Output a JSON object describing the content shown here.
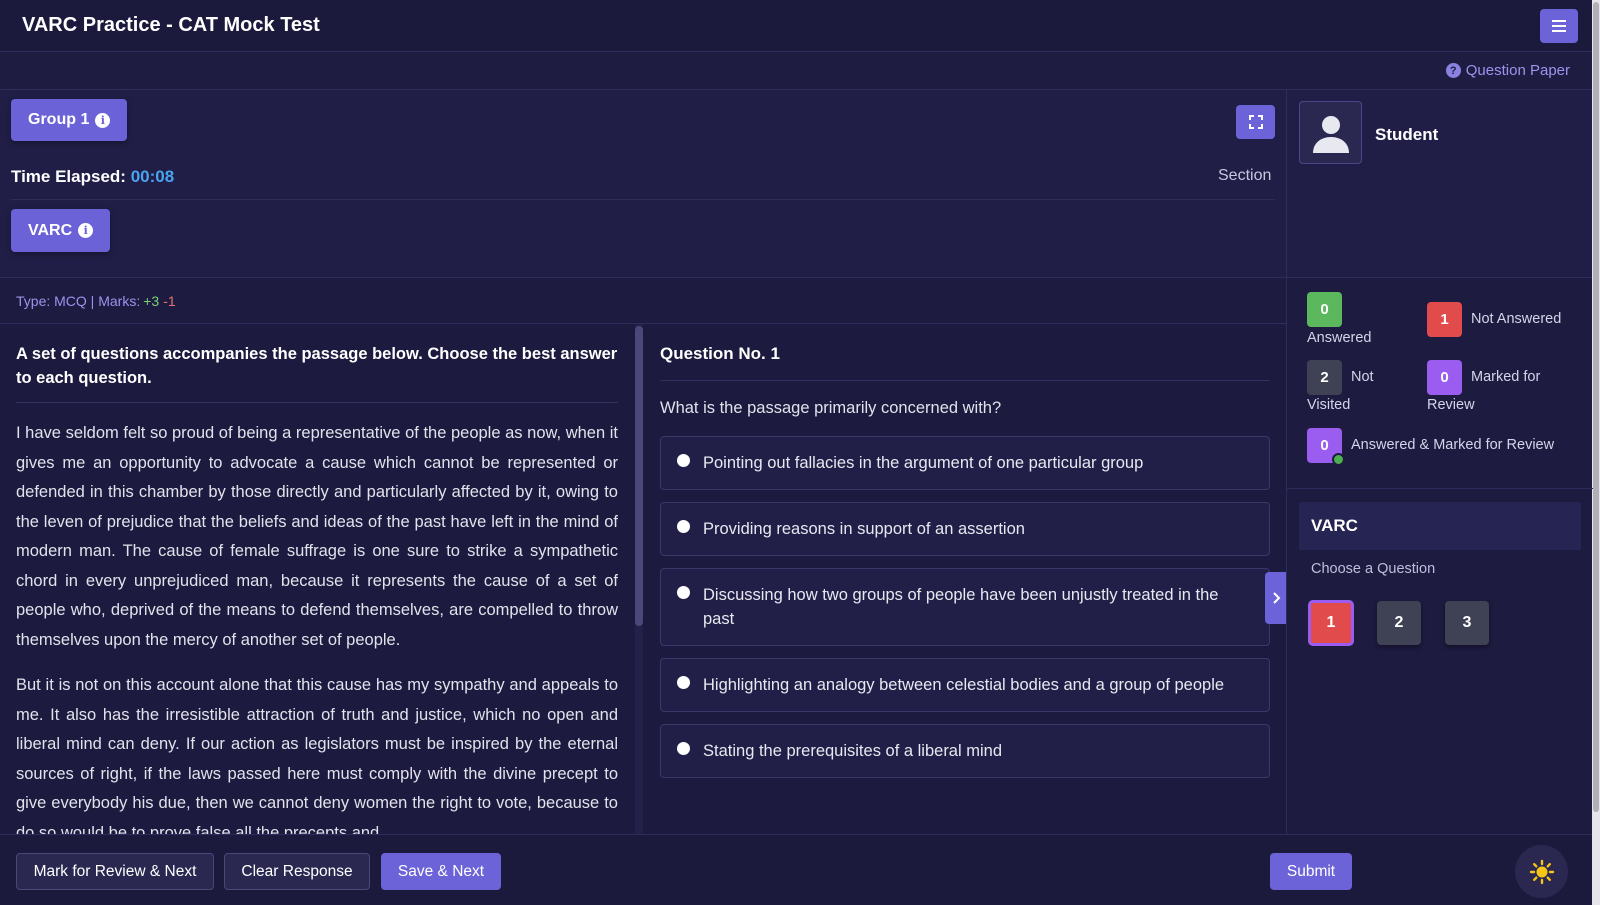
{
  "app": {
    "title": "VARC Practice - CAT Mock Test"
  },
  "toolbar": {
    "question_paper": "Question Paper"
  },
  "header": {
    "group_label": "Group 1",
    "time_label": "Time Elapsed:",
    "time_value": "00:08",
    "section_label": "Section",
    "section_tab": "VARC"
  },
  "profile": {
    "name": "Student"
  },
  "question_meta": {
    "type_text": "Type: MCQ | Marks:",
    "positive": "+3",
    "negative": "-1"
  },
  "passage": {
    "intro": "A set of questions accompanies the passage below. Choose the best answer to each question.",
    "paragraphs": [
      "I have seldom felt so proud of being a representative of the people as now, when it gives me an opportunity to advocate a cause which cannot be represented or defended in this chamber by those directly and particularly affected by it, owing to the leven of prejudice that the beliefs and ideas of the past have left in the mind of modern man. The cause of female suffrage is one sure to strike a sympathetic chord in every unprejudiced man, because it represents the cause of a set of people who, deprived of the means to defend themselves, are compelled to throw themselves upon the mercy of another set of people.",
      "But it is not on this account alone that this cause has my sympathy and appeals to me. It also has the irresistible attraction of truth and justice, which no open and liberal mind can deny. If our action as legislators must be inspired by the eternal sources of right, if the laws passed here must comply with the divine precept to give everybody his due, then we cannot deny women the right to vote, because to do so would be to prove false all the precepts and"
    ]
  },
  "question": {
    "number_label": "Question No. 1",
    "text": "What is the passage primarily concerned with?",
    "options": [
      "Pointing out fallacies in the argument of one particular group",
      "Providing reasons in support of an assertion",
      "Discussing how two groups of people have been unjustly treated in the past",
      "Highlighting an analogy between celestial bodies and a group of people",
      "Stating the prerequisites of a liberal mind"
    ]
  },
  "legend": {
    "answered": {
      "count": "0",
      "label": "Answered",
      "color": "#5cb85c"
    },
    "not_answered": {
      "count": "1",
      "label": "Not Answered",
      "color": "#e14b4b"
    },
    "not_visited": {
      "count": "2",
      "label_1": "Not",
      "label_2": "Visited",
      "color": "#3f4155"
    },
    "marked": {
      "count": "0",
      "label_1": "Marked for",
      "label_2": "Review",
      "color": "#9b5cf0"
    },
    "answered_marked": {
      "count": "0",
      "label": "Answered & Marked for Review",
      "color": "#9b5cf0"
    }
  },
  "palette": {
    "section_title": "VARC",
    "choose_label": "Choose a Question",
    "questions": [
      "1",
      "2",
      "3"
    ]
  },
  "footer": {
    "mark_review": "Mark for Review & Next",
    "clear": "Clear Response",
    "save_next": "Save & Next",
    "submit": "Submit"
  }
}
